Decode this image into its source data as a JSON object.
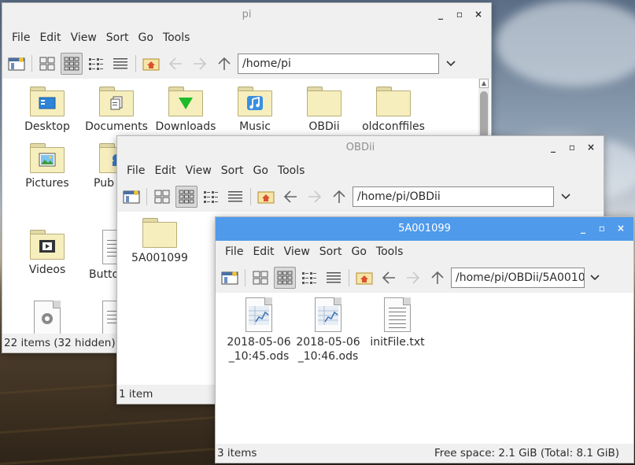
{
  "colors": {
    "active_title": "#4f9aeb",
    "chrome": "#f0f0f0",
    "folder": "#f6eebc",
    "download_arrow": "#1dbb27"
  },
  "win_pi": {
    "title": "pi",
    "menu": [
      "File",
      "Edit",
      "View",
      "Sort",
      "Go",
      "Tools"
    ],
    "path": "/home/pi",
    "items": [
      "Desktop",
      "Documents",
      "Downloads",
      "Music",
      "OBDii",
      "oldconffiles",
      "Pictures",
      "Pub",
      "Videos",
      "Butto"
    ],
    "status": "22 items (32 hidden)"
  },
  "win_obdii": {
    "title": "OBDii",
    "menu": [
      "File",
      "Edit",
      "View",
      "Sort",
      "Go",
      "Tools"
    ],
    "path": "/home/pi/OBDii",
    "items": [
      "5A001099"
    ],
    "status": "1 item"
  },
  "win_5a": {
    "title": "5A001099",
    "menu": [
      "File",
      "Edit",
      "View",
      "Sort",
      "Go",
      "Tools"
    ],
    "path": "/home/pi/OBDii/5A0010",
    "items": [
      {
        "line1": "2018-05-06",
        "line2": "_10:45.ods"
      },
      {
        "line1": "2018-05-06",
        "line2": "_10:46.ods"
      },
      {
        "line1": "initFile.txt",
        "line2": ""
      }
    ],
    "status": "3 items",
    "free_space": "Free space: 2.1 GiB (Total: 8.1 GiB)"
  },
  "window_controls": {
    "minimize": "_",
    "maximize": "▫",
    "close": "×"
  }
}
